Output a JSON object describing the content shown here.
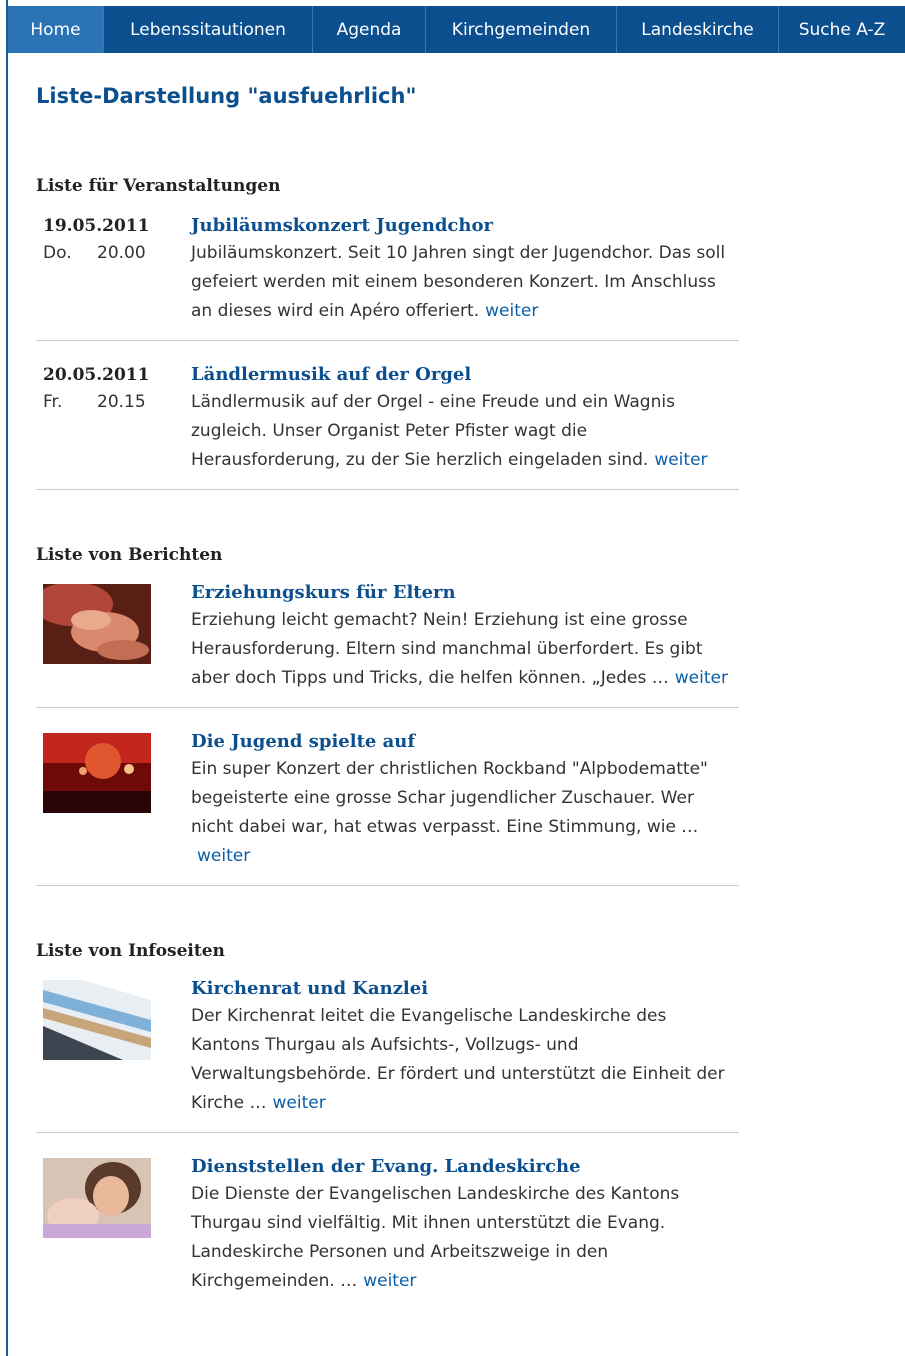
{
  "nav": {
    "items": [
      {
        "label": "Home",
        "active": true
      },
      {
        "label": "Lebenssitautionen",
        "active": false
      },
      {
        "label": "Agenda",
        "active": false
      },
      {
        "label": "Kirchgemeinden",
        "active": false
      },
      {
        "label": "Landeskirche",
        "active": false
      },
      {
        "label": "Suche A-Z",
        "active": false
      }
    ]
  },
  "page_title": "Liste-Darstellung \"ausfuehrlich\"",
  "weiter_label": "weiter",
  "events": {
    "heading": "Liste für Veranstaltungen",
    "items": [
      {
        "date": "19.05.2011",
        "day": "Do.",
        "time": "20.00",
        "title": "Jubiläumskonzert Jugendchor",
        "text": "Jubiläumskonzert. Seit 10 Jahren singt der Jugendchor. Das soll gefeiert werden mit einem besonderen Konzert. Im Anschluss an dieses wird ein Apéro offeriert."
      },
      {
        "date": "20.05.2011",
        "day": "Fr.",
        "time": "20.15",
        "title": "Ländlermusik auf der Orgel",
        "text": "Ländlermusik auf der Orgel - eine Freude und ein Wagnis zugleich. Unser Organist Peter Pfister wagt die Herausforderung, zu der Sie herzlich eingeladen sind."
      }
    ]
  },
  "reports": {
    "heading": "Liste von Berichten",
    "items": [
      {
        "title": "Erziehungskurs für Eltern",
        "text": "Erziehung leicht gemacht? Nein! Erziehung ist eine grosse Herausforderung. Eltern sind manchmal überfordert. Es gibt aber doch Tipps und Tricks, die helfen können. „Jedes …"
      },
      {
        "title": "Die Jugend spielte auf",
        "text": "Ein super Konzert der christlichen Rockband \"Alpbodematte\" begeisterte eine grosse Schar jugendlicher Zuschauer. Wer nicht dabei war, hat etwas verpasst. Eine Stimmung, wie …"
      }
    ]
  },
  "infopages": {
    "heading": "Liste von Infoseiten",
    "items": [
      {
        "title": "Kirchenrat und Kanzlei",
        "text": "Der Kirchenrat leitet die Evangelische Landeskirche des Kantons Thurgau als Aufsichts-, Vollzugs- und Verwaltungsbehörde. Er fördert und unterstützt die Einheit der Kirche …"
      },
      {
        "title": "Dienststellen der Evang. Landeskirche",
        "text": "Die Dienste der Evangelischen Landeskirche des Kantons Thurgau sind vielfältig. Mit ihnen unterstützt die Evang. Landeskirche Personen und Arbeitszweige in den Kirchgemeinden. …"
      }
    ]
  }
}
